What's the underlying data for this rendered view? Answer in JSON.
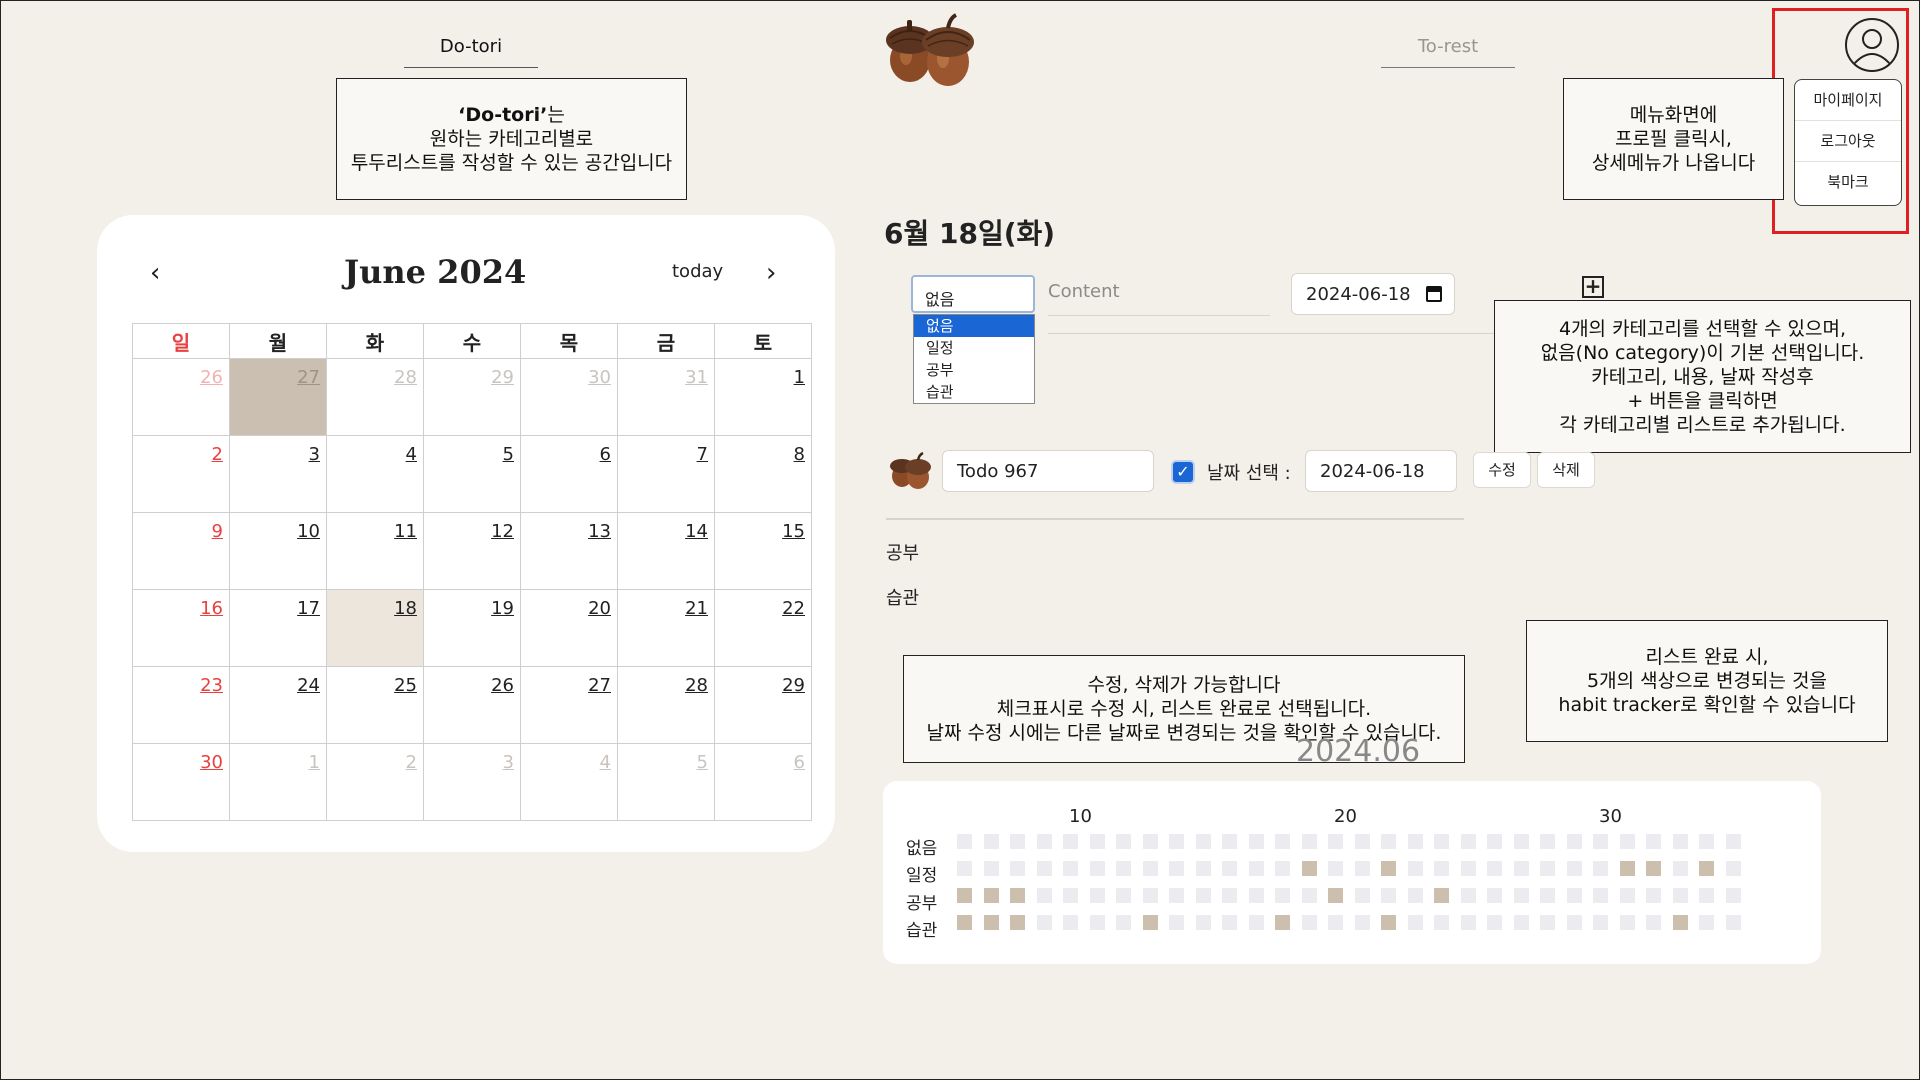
{
  "nav": {
    "left_tab": "Do-tori",
    "right_tab": "To-rest"
  },
  "notes": {
    "dotori": {
      "line1_bold": "‘Do-tori’",
      "line1_rest": "는",
      "line2": "원하는 카테고리별로",
      "line3": "투두리스트를 작성할 수 있는 공간입니다"
    },
    "menu": {
      "line1": "메뉴화면에",
      "line2": "프로필 클릭시,",
      "line3": "상세메뉴가 나옵니다"
    },
    "category": {
      "line1": "4개의 카테고리를 선택할 수 있으며,",
      "line2": "없음(No category)이 기본 선택입니다.",
      "line3": "카테고리, 내용, 날짜 작성후",
      "line4": "+ 버튼을 클릭하면",
      "line5": "각 카테고리별 리스트로 추가됩니다."
    },
    "edit": {
      "line1": "수정, 삭제가 가능합니다",
      "line2": "체크표시로 수정 시,  리스트 완료로 선택됩니다.",
      "line3": "날짜 수정 시에는 다른 날짜로 변경되는 것을 확인할 수 있습니다."
    },
    "habit": {
      "line1": "리스트 완료 시,",
      "line2": "5개의 색상으로 변경되는 것을",
      "line3": "habit tracker로 확인할 수 있습니다"
    }
  },
  "profile_menu": {
    "items": [
      "마이페이지",
      "로그아웃",
      "북마크"
    ]
  },
  "calendar": {
    "title": "June 2024",
    "today_label": "today",
    "prev": "‹",
    "next": "›",
    "weekdays": [
      "일",
      "월",
      "화",
      "수",
      "목",
      "금",
      "토"
    ],
    "weeks": [
      [
        "26",
        "27",
        "28",
        "29",
        "30",
        "31",
        "1"
      ],
      [
        "2",
        "3",
        "4",
        "5",
        "6",
        "7",
        "8"
      ],
      [
        "9",
        "10",
        "11",
        "12",
        "13",
        "14",
        "15"
      ],
      [
        "16",
        "17",
        "18",
        "19",
        "20",
        "21",
        "22"
      ],
      [
        "23",
        "24",
        "25",
        "26",
        "27",
        "28",
        "29"
      ],
      [
        "30",
        "1",
        "2",
        "3",
        "4",
        "5",
        "6"
      ]
    ]
  },
  "form": {
    "date_heading": "6월 18일(화)",
    "category_selected": "없음",
    "category_options": [
      "없음",
      "일정",
      "공부",
      "습관"
    ],
    "content_placeholder": "Content",
    "date_value": "2024-06-18",
    "add_symbol": "+"
  },
  "todo": {
    "text": "Todo 967",
    "checked": true,
    "check_mark": "✓",
    "date_label": "날짜 선택 :",
    "date_value": "2024-06-18",
    "edit_label": "수정",
    "delete_label": "삭제"
  },
  "categories": {
    "study": "공부",
    "habit": "습관"
  },
  "tracker": {
    "year_month": "2024.06",
    "ticks": [
      "10",
      "20",
      "30"
    ],
    "rows": [
      {
        "label": "없음",
        "done_days": []
      },
      {
        "label": "일정",
        "done_days": [
          14,
          17,
          26,
          27,
          29
        ]
      },
      {
        "label": "공부",
        "done_days": [
          1,
          2,
          3,
          15,
          19
        ]
      },
      {
        "label": "습관",
        "done_days": [
          1,
          2,
          3,
          8,
          13,
          17,
          28
        ]
      }
    ],
    "days": 30,
    "off_color": "#ebebf0",
    "on_color": "#cdbfae"
  },
  "colors": {
    "background": "#f3efe9",
    "accent_red": "#e02020",
    "sunday": "#e8413f",
    "selected_day": "#cbbfb2",
    "today_cell": "#ede6dd",
    "checkbox": "#1a66d4"
  }
}
